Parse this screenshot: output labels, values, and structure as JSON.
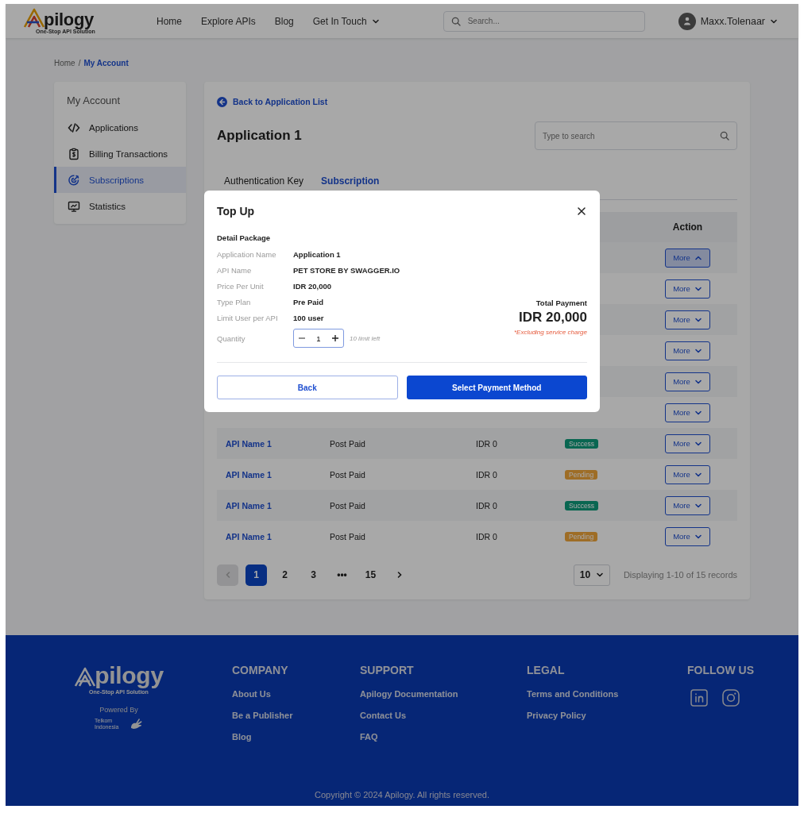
{
  "header": {
    "brand": {
      "name": "pilogy",
      "tagline": "One-Stop API Solution"
    },
    "nav": [
      {
        "label": "Home",
        "dropdown": false
      },
      {
        "label": "Explore APIs",
        "dropdown": false
      },
      {
        "label": "Blog",
        "dropdown": false
      },
      {
        "label": "Get In Touch",
        "dropdown": true
      }
    ],
    "search": {
      "placeholder": "Search..."
    },
    "user": {
      "name": "Maxx.Tolenaar"
    }
  },
  "breadcrumb": {
    "separator": "/",
    "items": [
      {
        "label": "Home",
        "current": false
      },
      {
        "label": "My Account",
        "current": true
      }
    ]
  },
  "sidebar": {
    "title": "My Account",
    "items": [
      {
        "label": "Applications",
        "selected": false
      },
      {
        "label": "Billing Transactions",
        "selected": false
      },
      {
        "label": "Subscriptions",
        "selected": true
      },
      {
        "label": "Statistics",
        "selected": false
      }
    ]
  },
  "main": {
    "back_link": "Back to Application List",
    "title": "Application 1",
    "search": {
      "placeholder": "Type to search"
    },
    "tabs": [
      {
        "label": "Authentication Key",
        "selected": false
      },
      {
        "label": "Subscription",
        "selected": true
      }
    ],
    "table": {
      "columns": [
        "Action"
      ],
      "rows": [
        {
          "action": {
            "label": "More",
            "expanded": true
          }
        },
        {
          "action": {
            "label": "More",
            "expanded": false
          }
        },
        {
          "action": {
            "label": "More",
            "expanded": false
          }
        },
        {
          "action": {
            "label": "More",
            "expanded": false
          }
        },
        {
          "action": {
            "label": "More",
            "expanded": false
          }
        },
        {
          "action": {
            "label": "More",
            "expanded": false
          }
        },
        {
          "api_name": "API Name 1",
          "plan": "Post Paid",
          "price": "IDR 0",
          "status": {
            "label": "Success",
            "kind": "success"
          },
          "action": {
            "label": "More",
            "expanded": false
          }
        },
        {
          "api_name": "API Name 1",
          "plan": "Post Paid",
          "price": "IDR 0",
          "status": {
            "label": "Pending",
            "kind": "pending"
          },
          "action": {
            "label": "More",
            "expanded": false
          }
        },
        {
          "api_name": "API Name 1",
          "plan": "Post Paid",
          "price": "IDR 0",
          "status": {
            "label": "Success",
            "kind": "success"
          },
          "action": {
            "label": "More",
            "expanded": false
          }
        },
        {
          "api_name": "API Name 1",
          "plan": "Post Paid",
          "price": "IDR 0",
          "status": {
            "label": "Pending",
            "kind": "pending"
          },
          "action": {
            "label": "More",
            "expanded": false
          }
        }
      ]
    },
    "pagination": {
      "prev": {
        "disabled": true
      },
      "pages": [
        {
          "label": "1",
          "selected": true
        },
        {
          "label": "2",
          "selected": false
        },
        {
          "label": "3",
          "selected": false
        },
        {
          "label": "•••",
          "selected": false
        },
        {
          "label": "15",
          "selected": false
        }
      ],
      "next": {
        "disabled": false
      },
      "page_size": "10",
      "summary": "Displaying 1-10 of 15 records"
    }
  },
  "modal": {
    "title": "Top Up",
    "section": "Detail Package",
    "details": [
      {
        "label": "Application Name",
        "value": "Application 1"
      },
      {
        "label": "API Name",
        "value": "PET STORE BY SWAGGER.IO"
      },
      {
        "label": "Price Per Unit",
        "value": "IDR 20,000"
      },
      {
        "label": "Type Plan",
        "value": "Pre Paid"
      },
      {
        "label": "Limit User per API",
        "value": "100 user"
      }
    ],
    "quantity": {
      "label": "Quantity",
      "value": "1",
      "hint": "10 limit left"
    },
    "total": {
      "label": "Total Payment",
      "amount": "IDR 20,000",
      "note": "*Excluding service charge"
    },
    "buttons": [
      {
        "label": "Back",
        "kind": "secondary"
      },
      {
        "label": "Select Payment Method",
        "kind": "primary"
      }
    ]
  },
  "footer": {
    "brand": {
      "name": "pilogy",
      "tagline": "One-Stop API Solution",
      "powered_by": "Powered By",
      "partner": "Telkom Indonesia"
    },
    "columns": [
      {
        "title": "COMPANY",
        "links": [
          "About Us",
          "Be a Publisher",
          "Blog"
        ]
      },
      {
        "title": "SUPPORT",
        "links": [
          "Apilogy Documentation",
          "Contact Us",
          "FAQ"
        ]
      },
      {
        "title": "LEGAL",
        "links": [
          "Terms and Conditions",
          "Privacy Policy"
        ]
      }
    ],
    "follow": {
      "title": "FOLLOW US"
    },
    "copyright": "Copyright © 2024 Apilogy. All rights reserved."
  }
}
